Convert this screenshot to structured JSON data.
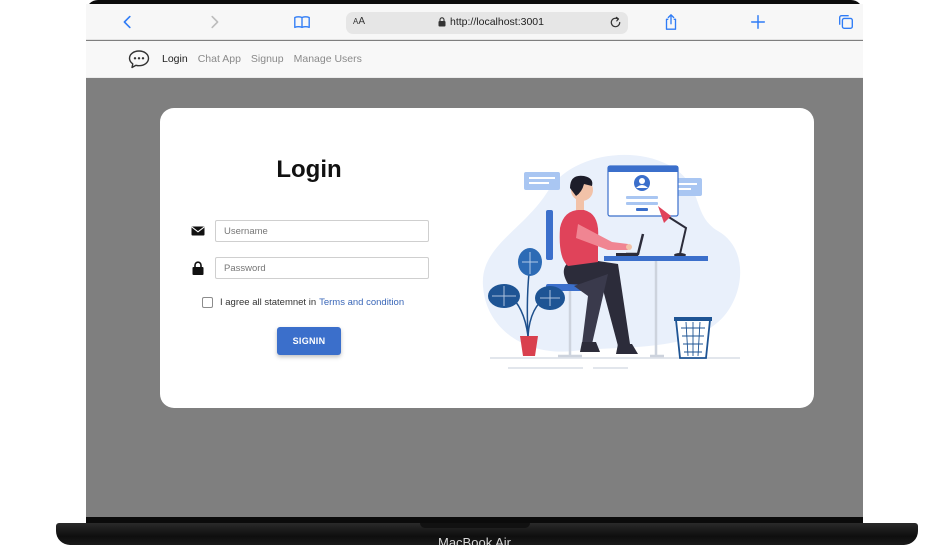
{
  "device": {
    "label": "MacBook Air"
  },
  "browser": {
    "text_size_label_small": "A",
    "text_size_label_large": "A",
    "url": "http://localhost:3001"
  },
  "app_nav": {
    "links": [
      "Login",
      "Chat App",
      "Signup",
      "Manage Users"
    ],
    "active_index": 0
  },
  "login": {
    "title": "Login",
    "username_placeholder": "Username",
    "password_placeholder": "Password",
    "agree_text": "I agree all statemnet in",
    "terms_link": "Terms and condition",
    "signin_label": "SIGNIN",
    "agree_checked": false
  },
  "colors": {
    "accent": "#3b6fcb",
    "link": "#3a67b8",
    "backdrop": "#7f7f7f"
  }
}
